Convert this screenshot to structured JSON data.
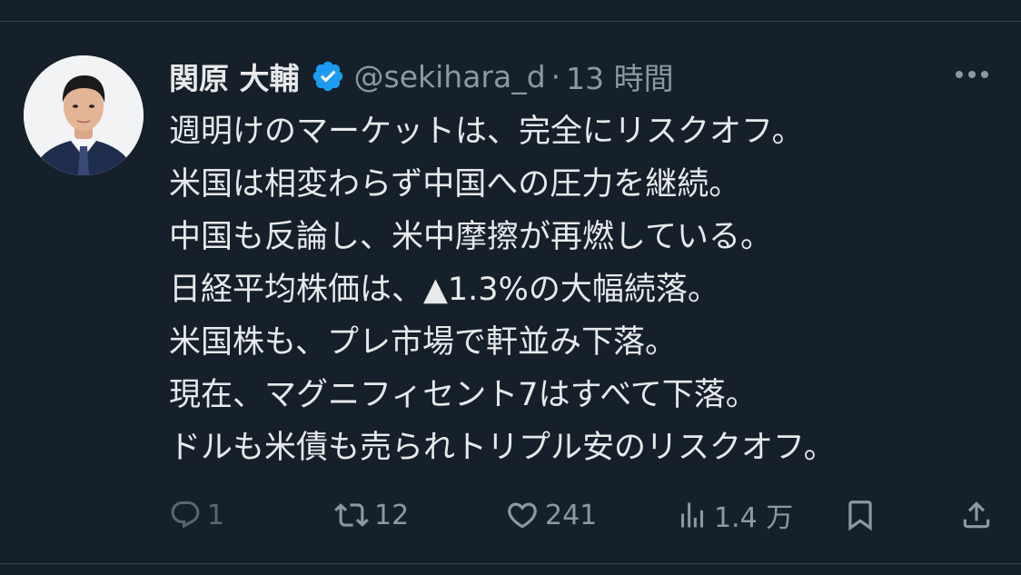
{
  "tweet": {
    "author": {
      "display_name": "関原 大輔",
      "handle": "@sekihara_d",
      "separator": "·",
      "timestamp": "13 時間",
      "verified": true,
      "verified_color": "#1d9bf0"
    },
    "body_lines": [
      "週明けのマーケットは、完全にリスクオフ。",
      "米国は相変わらず中国への圧力を継続。",
      "中国も反論し、米中摩擦が再燃している。",
      "日経平均株価は、▲1.3%の大幅続落。",
      "米国株も、プレ市場で軒並み下落。",
      "現在、マグニフィセント7はすべて下落。",
      "ドルも米債も売られトリプル安のリスクオフ。"
    ],
    "actions": {
      "reply": {
        "icon": "reply-icon",
        "count": "1"
      },
      "retweet": {
        "icon": "retweet-icon",
        "count": "12"
      },
      "like": {
        "icon": "heart-icon",
        "count": "241"
      },
      "views": {
        "icon": "views-icon",
        "count": "1.4 万"
      },
      "bookmark": {
        "icon": "bookmark-icon"
      },
      "share": {
        "icon": "share-icon"
      }
    }
  },
  "theme": {
    "background": "#15202b",
    "text_primary": "#e7e9ea",
    "text_secondary": "#8b98a5",
    "divider": "#38444d"
  }
}
